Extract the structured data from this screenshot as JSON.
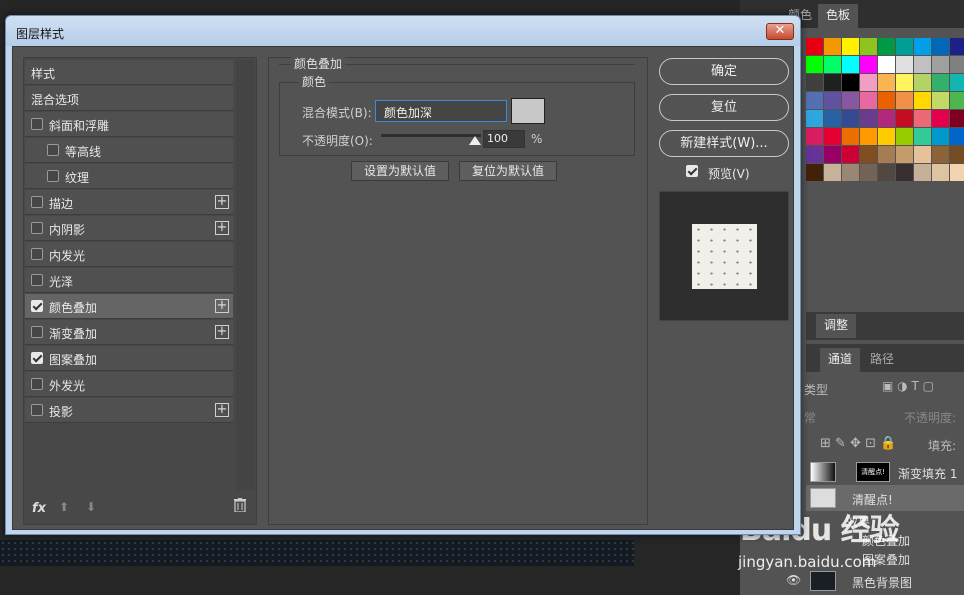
{
  "dialog": {
    "title": "图层样式",
    "close_symbol": "✕"
  },
  "style_list": {
    "header": "样式",
    "blend_options": "混合选项",
    "items": [
      {
        "label": "斜面和浮雕",
        "checked": false,
        "has_add": false
      },
      {
        "label": "等高线",
        "checked": false,
        "has_add": false
      },
      {
        "label": "纹理",
        "checked": false,
        "has_add": false
      },
      {
        "label": "描边",
        "checked": false,
        "has_add": true
      },
      {
        "label": "内阴影",
        "checked": false,
        "has_add": true
      },
      {
        "label": "内发光",
        "checked": false,
        "has_add": false
      },
      {
        "label": "光泽",
        "checked": false,
        "has_add": false
      },
      {
        "label": "颜色叠加",
        "checked": true,
        "has_add": true,
        "selected": true
      },
      {
        "label": "渐变叠加",
        "checked": false,
        "has_add": true
      },
      {
        "label": "图案叠加",
        "checked": true,
        "has_add": false
      },
      {
        "label": "外发光",
        "checked": false,
        "has_add": false
      },
      {
        "label": "投影",
        "checked": false,
        "has_add": true
      }
    ],
    "fx_label": "fx"
  },
  "settings": {
    "group_title": "颜色叠加",
    "sub_title": "颜色",
    "blend_mode_label": "混合模式(B):",
    "blend_mode_value": "颜色加深",
    "overlay_color": "#c8c8c8",
    "opacity_label": "不透明度(O):",
    "opacity_value": "100",
    "opacity_unit": "%",
    "set_default": "设置为默认值",
    "reset_default": "复位为默认值"
  },
  "buttons": {
    "ok": "确定",
    "reset": "复位",
    "new_style": "新建样式(W)...",
    "preview": "预览(V)",
    "preview_checked": true
  },
  "background": {
    "tab_swatches_hidden": "颜色",
    "tab_swatches": "色板",
    "tab_adjust": "调整",
    "tab_channels": "通道",
    "tab_paths": "路径",
    "filter_kind": "类型",
    "blend_normal": "常",
    "opacity_label": "不透明度:",
    "fill_label": "填充:",
    "layers": [
      {
        "name": "渐变填充 1",
        "thumb_text": "清醒点!"
      },
      {
        "name": "清醒点!"
      },
      {
        "name": "效果"
      },
      {
        "name": "颜色叠加"
      },
      {
        "name": "图案叠加"
      },
      {
        "name": "黑色背景图"
      }
    ],
    "watermark": "Baidu 经验",
    "watermark_url": "jingyan.baidu.com"
  },
  "swatch_colors": [
    "#e60012",
    "#f39800",
    "#fff100",
    "#8fc31f",
    "#009944",
    "#009e96",
    "#00a0e9",
    "#0068b7",
    "#1d2088",
    "#920783",
    "#00ff00",
    "#00ff66",
    "#00ffff",
    "#ff00ff",
    "#ffffff",
    "#e0e0e0",
    "#c0c0c0",
    "#a0a0a0",
    "#808080",
    "#606060",
    "#404040",
    "#202020",
    "#000000",
    "#f19ec2",
    "#f8b551",
    "#fff45c",
    "#b3d465",
    "#32b16c",
    "#13b5b1",
    "#448aca",
    "#556fb5",
    "#5f52a0",
    "#8957a1",
    "#ea68a2",
    "#eb6100",
    "#f19149",
    "#ffd800",
    "#c2d967",
    "#4fb64f",
    "#14b6b3",
    "#2ea7e0",
    "#2662a4",
    "#354a92",
    "#6a3c8e",
    "#b4287c",
    "#c30d23",
    "#eb6877",
    "#e5004f",
    "#7d0022",
    "#a40b5d",
    "#d81d62",
    "#e60033",
    "#ec6d00",
    "#ff9900",
    "#ffcc00",
    "#99cc00",
    "#33cc99",
    "#0099cc",
    "#0066cc",
    "#3333cc",
    "#663399",
    "#990066",
    "#cc0033",
    "#7f4f21",
    "#a67c52",
    "#c69c6d",
    "#e6c19a",
    "#8c6239",
    "#754c24",
    "#603913",
    "#42210b",
    "#c7b299",
    "#998675",
    "#736357",
    "#534741",
    "#362f2d",
    "#c6b198",
    "#ddc3a0",
    "#f0d5b0",
    "#ffe7c6"
  ]
}
